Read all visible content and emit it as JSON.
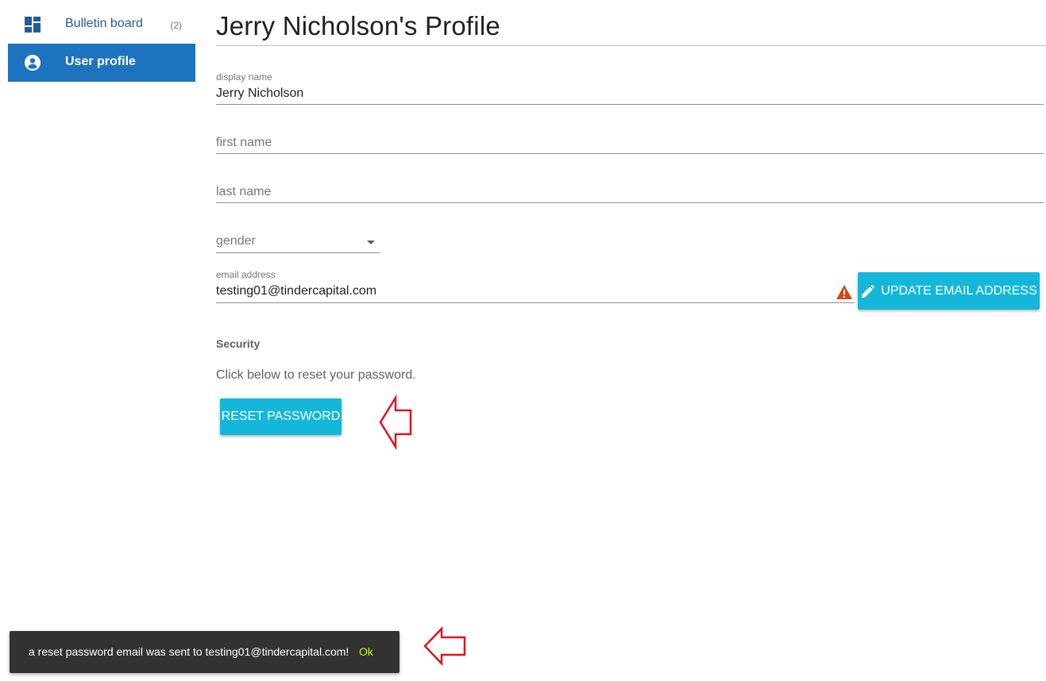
{
  "sidebar": {
    "items": [
      {
        "label": "Bulletin board",
        "count": "(2)",
        "icon": "dashboard-icon"
      },
      {
        "label": "User profile",
        "icon": "account-circle-icon",
        "active": true
      }
    ]
  },
  "main": {
    "title": "Jerry Nicholson's Profile",
    "fields": {
      "display_name": {
        "label": "display name",
        "value": "Jerry Nicholson"
      },
      "first_name": {
        "placeholder": "first name"
      },
      "last_name": {
        "placeholder": "last name"
      },
      "gender": {
        "placeholder": "gender"
      },
      "email": {
        "label": "email address",
        "value": "testing01@tindercapital.com",
        "status_icon": "warning-icon"
      }
    },
    "update_email_button": "UPDATE EMAIL ADDRESS",
    "security": {
      "heading": "Security",
      "text": "Click below to reset your password.",
      "reset_button": "RESET PASSWORD"
    }
  },
  "snackbar": {
    "message": "a reset password email was sent to testing01@tindercapital.com!",
    "action": "Ok"
  },
  "colors": {
    "nav_active_bg": "#1e73be",
    "nav_link": "#1f5c99",
    "button": "#14b7d9",
    "warning": "#d84315",
    "snackbar_bg": "#323232",
    "snackbar_action": "#c6ff00",
    "annotation_arrow": "#e0141e"
  }
}
